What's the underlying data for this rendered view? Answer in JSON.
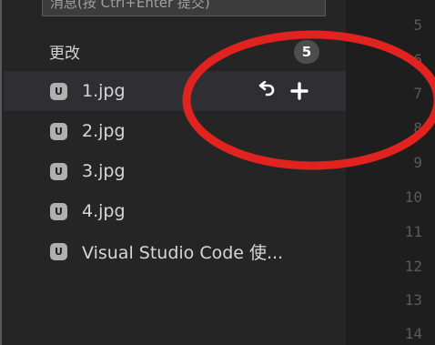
{
  "commit_message": {
    "placeholder": "消息(按 Ctrl+Enter 提交)"
  },
  "changes": {
    "title": "更改",
    "count": "5",
    "files": [
      {
        "name": "1.jpg",
        "status": "U"
      },
      {
        "name": "2.jpg",
        "status": "U"
      },
      {
        "name": "3.jpg",
        "status": "U"
      },
      {
        "name": "4.jpg",
        "status": "U"
      },
      {
        "name": "Visual Studio Code 使...",
        "status": "U"
      }
    ],
    "row_actions": {
      "discard_icon": "undo-arrow-icon",
      "stage_icon": "plus-icon"
    }
  },
  "editor_gutter": {
    "line_numbers": [
      "5",
      "6",
      "7",
      "8",
      "9",
      "10",
      "11",
      "12",
      "13",
      "14"
    ]
  },
  "annotation": {
    "color": "#e0231f"
  }
}
